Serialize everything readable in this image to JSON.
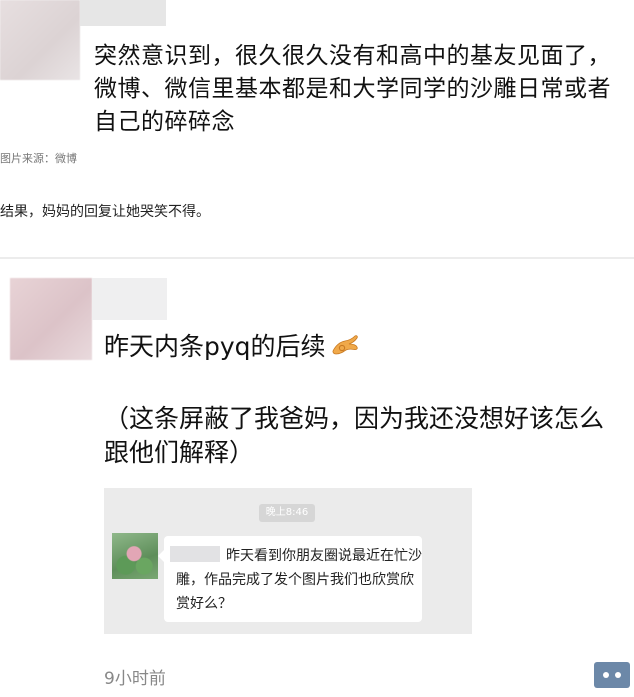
{
  "post1": {
    "text": "突然意识到，很久很久没有和高中的基友见面了，微博、微信里基本都是和大学同学的沙雕日常或者自己的碎碎念"
  },
  "source_label": "图片来源：微博",
  "caption": "结果，妈妈的回复让她哭笑不得。",
  "post2": {
    "line1": "昨天内条pyq的后续",
    "paragraph": "（这条屏蔽了我爸妈，因为我还没想好该怎么跟他们解释）",
    "emoji_icon": "ok-hand-emoji",
    "chat": {
      "time_label": "晚上8:46",
      "message": "昨天看到你朋友圈说最近在忙沙雕，作品完成了发个图片我们也欣赏欣赏好么？"
    },
    "time_ago": "9小时前"
  },
  "colors": {
    "more_button_bg": "#6c88a8",
    "divider": "#ececec",
    "emoji_fill": "#f0a94a"
  }
}
